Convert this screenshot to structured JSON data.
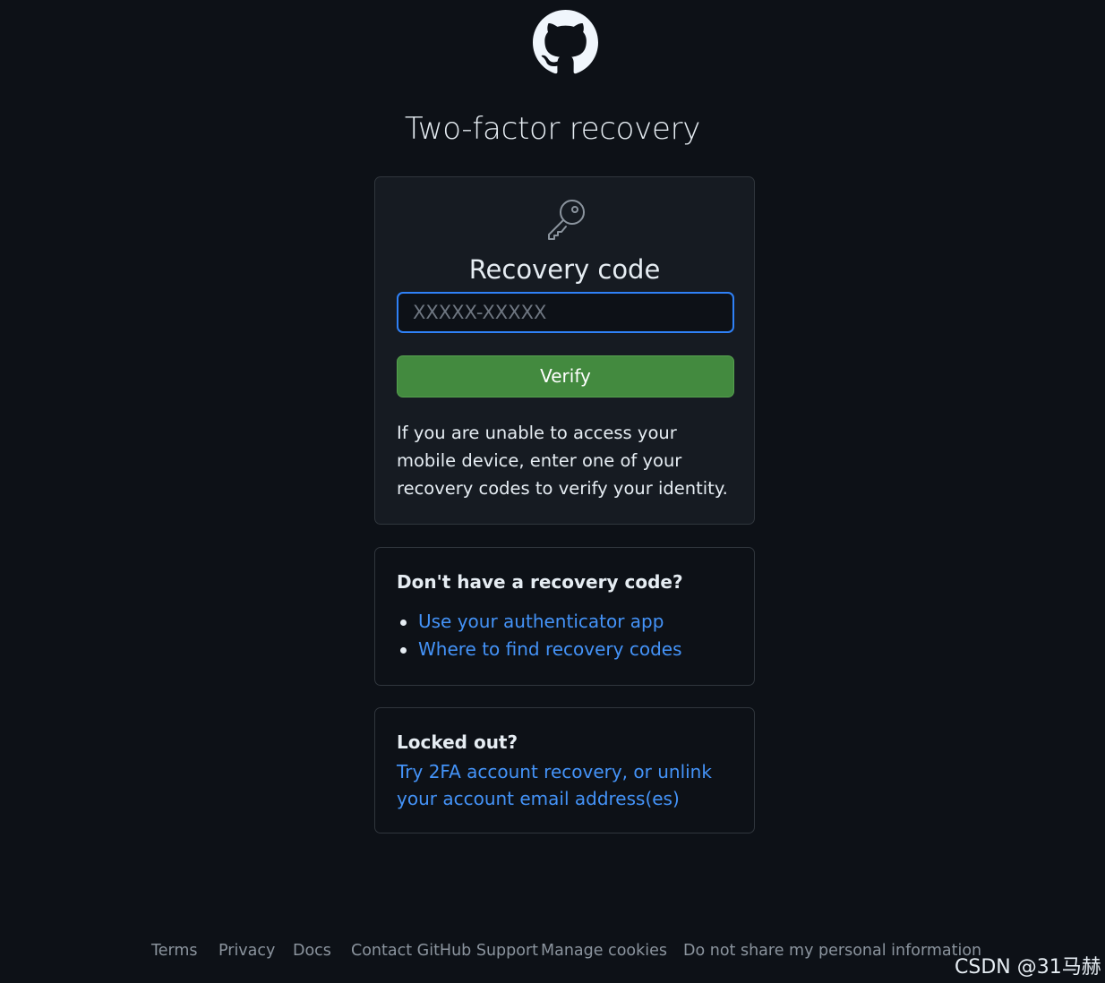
{
  "header": {
    "logo_icon": "github-mark-icon",
    "title": "Two-factor recovery"
  },
  "main_box": {
    "icon": "key-icon",
    "label": "Recovery code",
    "input_placeholder": "XXXXX-XXXXX",
    "input_value": "",
    "verify_label": "Verify",
    "help_text": "If you are unable to access your mobile device, enter one of your recovery codes to verify your identity."
  },
  "no_code_box": {
    "heading": "Don't have a recovery code?",
    "links": [
      {
        "label": "Use your authenticator app"
      },
      {
        "label": "Where to find recovery codes"
      }
    ]
  },
  "locked_box": {
    "heading": "Locked out?",
    "link_label": "Try 2FA account recovery, or unlink your account email address(es)"
  },
  "footer": {
    "links": [
      {
        "label": "Terms"
      },
      {
        "label": "Privacy"
      },
      {
        "label": "Docs"
      },
      {
        "label": "Contact GitHub Support"
      },
      {
        "label": "Manage cookies"
      },
      {
        "label": "Do not share my personal information"
      }
    ]
  },
  "watermark": "CSDN @31马赫",
  "colors": {
    "background": "#0d1117",
    "card": "#161b22",
    "border": "#30363d",
    "accent_blue": "#2f81f7",
    "link": "#4493f8",
    "button_green": "#438a3f"
  }
}
